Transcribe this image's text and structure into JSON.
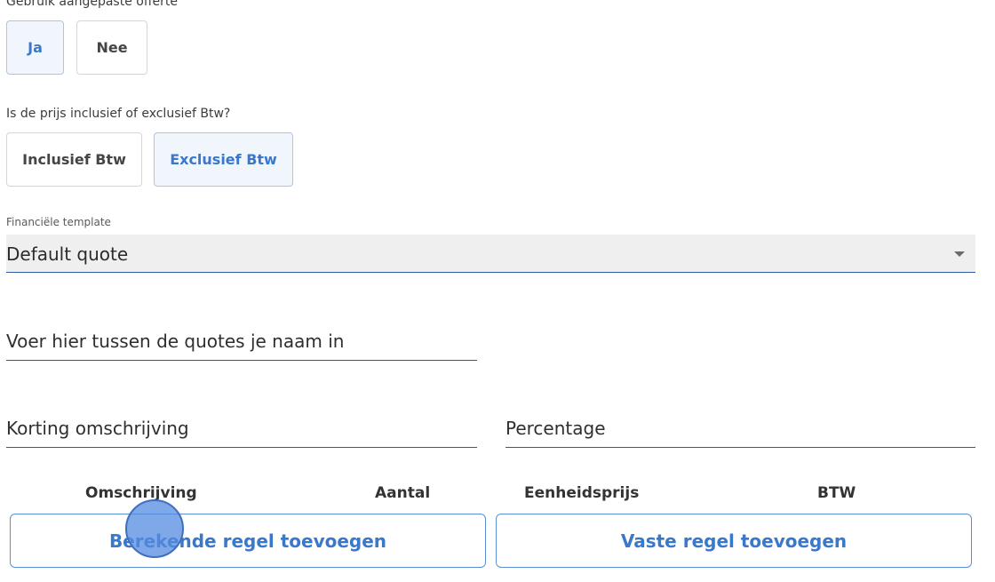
{
  "custom_quote": {
    "label": "Gebruik aangepaste offerte",
    "yes": "Ja",
    "no": "Nee",
    "selected": "Ja"
  },
  "vat": {
    "label": "Is de prijs inclusief of exclusief Btw?",
    "inclusive": "Inclusief Btw",
    "exclusive": "Exclusief Btw",
    "selected": "Exclusief Btw"
  },
  "template": {
    "label": "Financiële template",
    "value": "Default quote"
  },
  "name_field": {
    "label": "Voer hier tussen de quotes je naam in"
  },
  "discount": {
    "description_label": "Korting omschrijving",
    "percentage_label": "Percentage"
  },
  "table_headers": [
    "Omschrijving",
    "Aantal",
    "Eenheidsprijs",
    "BTW"
  ],
  "actions": {
    "add_calculated": "Berekende regel toevoegen",
    "add_fixed": "Vaste regel toevoegen"
  },
  "colors": {
    "accent": "#3a78cc",
    "selected_bg": "#f1f6fc",
    "touch_indicator": "#548be0"
  }
}
